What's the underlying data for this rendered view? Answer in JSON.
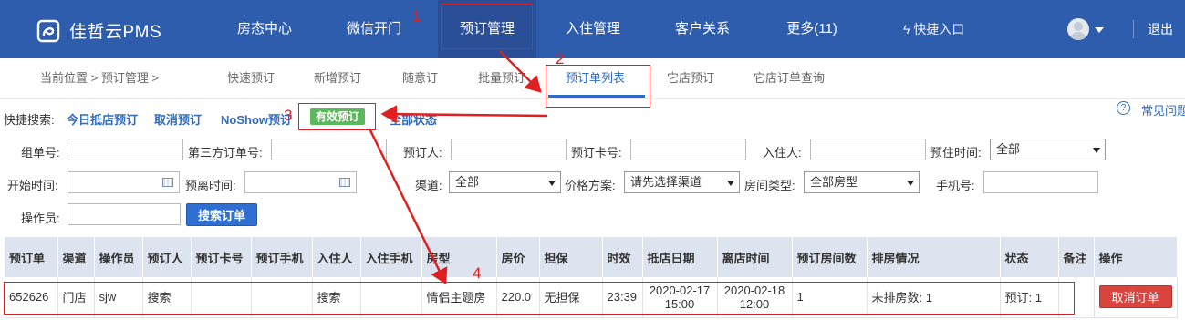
{
  "header": {
    "logo_text": "佳哲云PMS",
    "nav": [
      "房态中心",
      "微信开门",
      "预订管理",
      "入住管理",
      "客户关系",
      "更多(11)"
    ],
    "quick_entry": "快捷入口",
    "logout": "退出",
    "accent": "#2f5dae"
  },
  "subnav": {
    "breadcrumb": "当前位置 > 预订管理 >",
    "tabs": [
      "快速预订",
      "新增预订",
      "随意订",
      "批量预订",
      "预订单列表",
      "它店预订",
      "它店订单查询"
    ],
    "active_tab": "预订单列表"
  },
  "quick_search": {
    "label": "快捷搜索:",
    "links": [
      "今日抵店预订",
      "取消预订",
      "NoShow预订"
    ],
    "active_button": "有效预订",
    "last_link": "全部状态",
    "help": "常见问题"
  },
  "form": {
    "group_no": "组单号:",
    "third_party_no": "第三方订单号:",
    "booker": "预订人:",
    "booking_card": "预订卡号:",
    "guest": "入住人:",
    "pre_checkin": "预住时间:",
    "pre_checkin_value": "全部",
    "start_time": "开始时间:",
    "depart_time": "预离时间:",
    "channel": "渠道:",
    "channel_value": "全部",
    "price_plan": "价格方案:",
    "price_plan_value": "请先选择渠道",
    "room_type": "房间类型:",
    "room_type_value": "全部房型",
    "phone": "手机号:",
    "operator": "操作员:",
    "search_button": "搜索订单"
  },
  "table": {
    "headers": [
      "预订单",
      "渠道",
      "操作员",
      "预订人",
      "预订卡号",
      "预订手机",
      "入住人",
      "入住手机",
      "房型",
      "房价",
      "担保",
      "时效",
      "抵店日期",
      "离店时间",
      "预订房间数",
      "排房情况",
      "状态",
      "备注",
      "操作"
    ],
    "rows": [
      {
        "order_no": "652626",
        "channel": "门店",
        "operator": "sjw",
        "booker": "搜索",
        "card": "",
        "phone": "",
        "guest": "搜索",
        "guest_phone": "",
        "room_type": "情侣主题房",
        "price": "220.0",
        "guarantee": "无担保",
        "validity": "23:39",
        "arrive_date": "2020-02-17",
        "arrive_time": "15:00",
        "depart_date": "2020-02-18",
        "depart_time": "12:00",
        "room_count": "1",
        "allocation": "未排房数: 1",
        "status": "预订: 1",
        "note": "",
        "action": "取消订单"
      }
    ]
  },
  "annotations": [
    "1",
    "2",
    "3",
    "4"
  ]
}
